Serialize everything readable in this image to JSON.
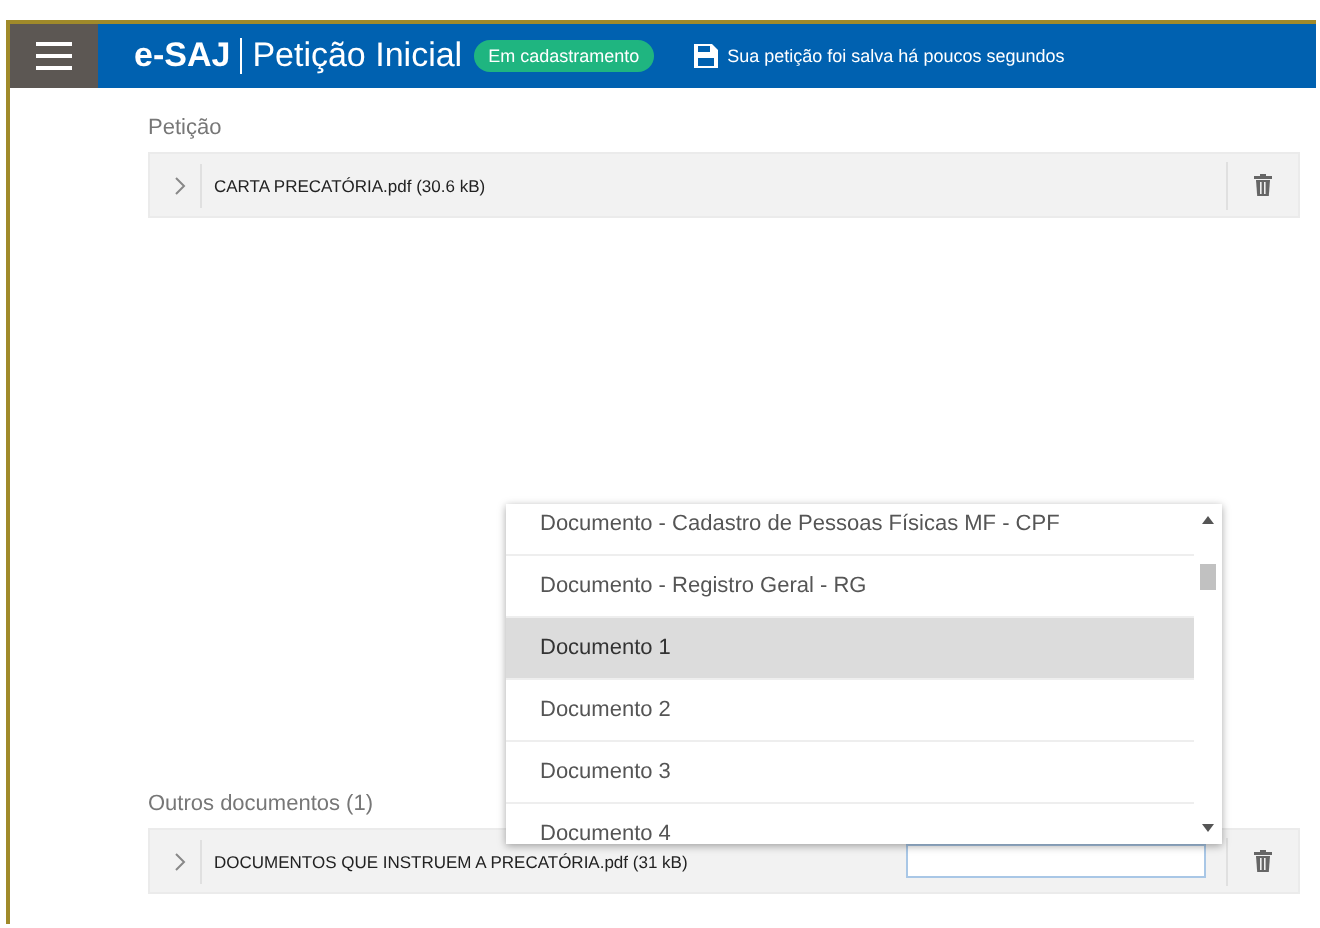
{
  "header": {
    "brand": "e-SAJ",
    "title": "Petição Inicial",
    "status_badge": "Em cadastramento",
    "save_message": "Sua petição foi salva há poucos segundos"
  },
  "sections": [
    {
      "label": "Petição",
      "files": [
        {
          "name": "CARTA PRECATÓRIA.pdf (30.6 kB)",
          "expanded": false,
          "type_field": false
        }
      ]
    },
    {
      "label": "Outros documentos (1)",
      "files": [
        {
          "name": "DOCUMENTOS QUE INSTRUEM A PRECATÓRIA.pdf (31 kB)",
          "expanded": false,
          "type_field": true
        }
      ]
    }
  ],
  "dropdown": {
    "options": [
      {
        "label": "Documento - Cadastro de Pessoas Físicas MF - CPF",
        "selected": false
      },
      {
        "label": "Documento - Registro Geral - RG",
        "selected": false
      },
      {
        "label": "Documento 1",
        "selected": true
      },
      {
        "label": "Documento 2",
        "selected": false
      },
      {
        "label": "Documento 3",
        "selected": false
      },
      {
        "label": "Documento 4",
        "selected": false
      }
    ]
  }
}
